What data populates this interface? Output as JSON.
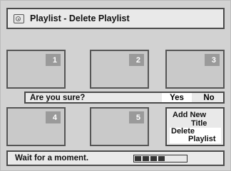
{
  "title_bar": {
    "title": "Playlist - Delete Playlist",
    "icon": "disc-icon"
  },
  "thumbnails": [
    {
      "number": "1"
    },
    {
      "number": "2"
    },
    {
      "number": "3"
    },
    {
      "number": "4"
    },
    {
      "number": "5"
    }
  ],
  "confirm": {
    "question": "Are you sure?",
    "yes_label": "Yes",
    "no_label": "No",
    "selected": "Yes"
  },
  "menu": {
    "item1_line1": "Add New",
    "item1_line2": "Title",
    "item2_line1": "Delete",
    "item2_line2": "Playlist",
    "selected": "Delete Playlist"
  },
  "status": {
    "message": "Wait for a moment.",
    "progress_segments_filled": 4,
    "progress_segments_total": 7
  },
  "colors": {
    "highlight": "#ffffff",
    "panel": "#e9e9e9",
    "background": "#d2d2d2"
  }
}
